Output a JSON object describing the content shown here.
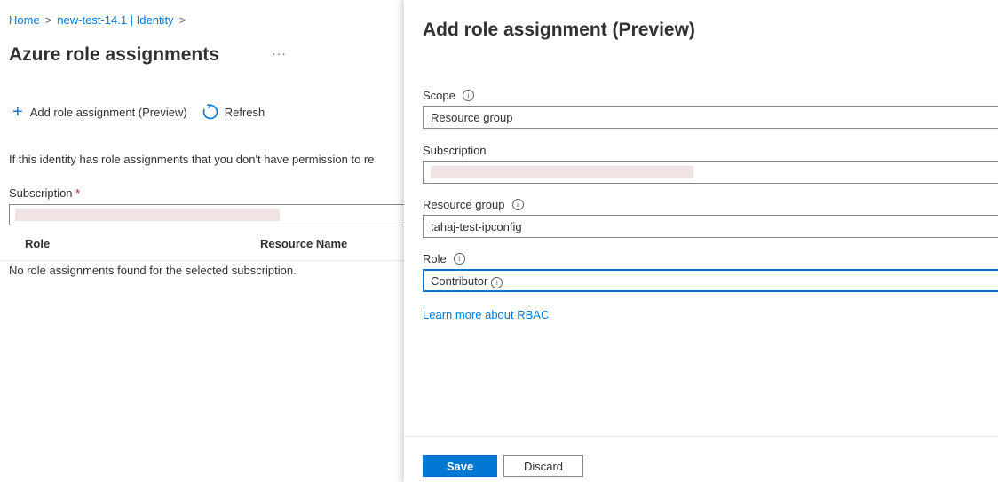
{
  "breadcrumb": {
    "home": "Home",
    "resource": "new-test-14.1 | Identity"
  },
  "page": {
    "title": "Azure role assignments",
    "more": "···"
  },
  "toolbar": {
    "add_label": "Add role assignment (Preview)",
    "refresh_label": "Refresh"
  },
  "info_text": "If this identity has role assignments that you don't have permission to re",
  "subscription": {
    "label": "Subscription",
    "required_mark": "*",
    "value": ""
  },
  "table": {
    "columns": [
      "Role",
      "Resource Name"
    ],
    "empty_message": "No role assignments found for the selected subscription."
  },
  "blade": {
    "title": "Add role assignment (Preview)",
    "scope": {
      "label": "Scope",
      "value": "Resource group"
    },
    "subscription": {
      "label": "Subscription",
      "value": ""
    },
    "resource_group": {
      "label": "Resource group",
      "value": "tahaj-test-ipconfig"
    },
    "role": {
      "label": "Role",
      "value": "Contributor"
    },
    "learn_more": "Learn more about RBAC",
    "save_label": "Save",
    "discard_label": "Discard"
  },
  "colors": {
    "accent": "#0078d4",
    "redacted": "#f1e3e4"
  }
}
